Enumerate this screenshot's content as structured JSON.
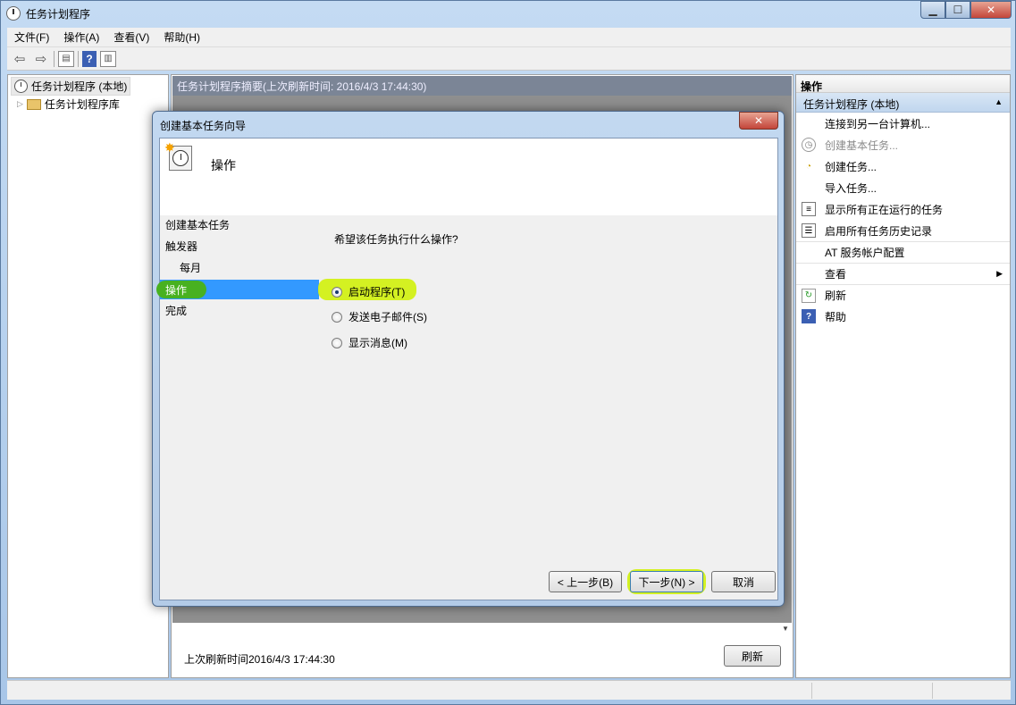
{
  "window": {
    "title": "任务计划程序"
  },
  "menu": [
    "文件(F)",
    "操作(A)",
    "查看(V)",
    "帮助(H)"
  ],
  "tree": {
    "root": "任务计划程序 (本地)",
    "child": "任务计划程序库"
  },
  "center": {
    "header": "任务计划程序摘要(上次刷新时间: 2016/4/3 17:44:30)",
    "last_refresh": "上次刷新时间2016/4/3 17:44:30",
    "refresh_button": "刷新"
  },
  "actions": {
    "title": "操作",
    "section": "任务计划程序 (本地)",
    "items": [
      {
        "label": "连接到另一台计算机...",
        "icon": "none",
        "enabled": true
      },
      {
        "label": "创建基本任务...",
        "icon": "wizard-icon",
        "enabled": false
      },
      {
        "label": "创建任务...",
        "icon": "task-icon",
        "enabled": true
      },
      {
        "label": "导入任务...",
        "icon": "none",
        "enabled": true
      },
      {
        "label": "显示所有正在运行的任务",
        "icon": "list-icon",
        "enabled": true
      },
      {
        "label": "启用所有任务历史记录",
        "icon": "history-icon",
        "enabled": true
      },
      {
        "label": "AT 服务帐户配置",
        "icon": "none",
        "enabled": true
      },
      {
        "label": "查看",
        "icon": "none",
        "enabled": true,
        "submenu": true
      },
      {
        "label": "刷新",
        "icon": "refresh-icon",
        "enabled": true
      },
      {
        "label": "帮助",
        "icon": "help-icon",
        "enabled": true
      }
    ]
  },
  "dialog": {
    "title": "创建基本任务向导",
    "close": "✕",
    "heading": "操作",
    "steps": [
      "创建基本任务",
      "触发器",
      "每月",
      "操作",
      "完成"
    ],
    "active_step": "操作",
    "question": "希望该任务执行什么操作?",
    "options": [
      {
        "label": "启动程序(T)",
        "checked": true
      },
      {
        "label": "发送电子邮件(S)",
        "checked": false
      },
      {
        "label": "显示消息(M)",
        "checked": false
      }
    ],
    "buttons": {
      "back": "< 上一步(B)",
      "next": "下一步(N) >",
      "cancel": "取消"
    }
  },
  "colors": {
    "selection": "#3399ff",
    "highlight_yellow": "#d2f016",
    "highlight_green": "#48b120"
  }
}
